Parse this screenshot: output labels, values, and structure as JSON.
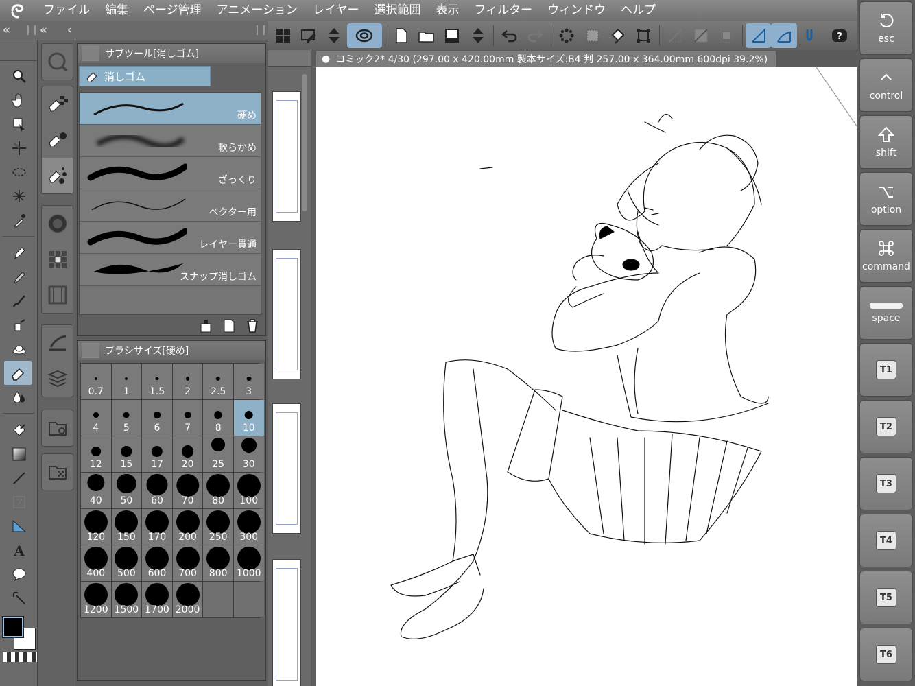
{
  "menu": {
    "items": [
      "ファイル",
      "編集",
      "ページ管理",
      "アニメーション",
      "レイヤー",
      "選択範囲",
      "表示",
      "フィルター",
      "ウィンドウ",
      "ヘルプ"
    ]
  },
  "subtool_panel": {
    "title": "サブツール[消しゴム]",
    "group_name": "消しゴム",
    "items": [
      {
        "label": "硬め",
        "selected": true
      },
      {
        "label": "軟らかめ",
        "selected": false
      },
      {
        "label": "ざっくり",
        "selected": false
      },
      {
        "label": "ベクター用",
        "selected": false
      },
      {
        "label": "レイヤー貫通",
        "selected": false
      },
      {
        "label": "スナップ消しゴム",
        "selected": false
      }
    ]
  },
  "brush_size_panel": {
    "title": "ブラシサイズ[硬め]",
    "selected": "10",
    "sizes": [
      "0.7",
      "1",
      "1.5",
      "2",
      "2.5",
      "3",
      "4",
      "5",
      "6",
      "7",
      "8",
      "10",
      "12",
      "15",
      "17",
      "20",
      "25",
      "30",
      "40",
      "50",
      "60",
      "70",
      "80",
      "100",
      "120",
      "150",
      "170",
      "200",
      "250",
      "300",
      "400",
      "500",
      "600",
      "700",
      "800",
      "1000",
      "1200",
      "1500",
      "1700",
      "2000"
    ]
  },
  "document": {
    "tab_title": "コミック2* 4/30 (297.00 x 420.00mm 製本サイズ:B4 判 257.00 x 364.00mm 600dpi 39.2%)"
  },
  "shortcuts": {
    "keys": [
      {
        "label": "esc",
        "icon": "undo-circle-icon"
      },
      {
        "label": "control",
        "icon": "caret-up-icon"
      },
      {
        "label": "shift",
        "icon": "shift-arrow-icon"
      },
      {
        "label": "option",
        "icon": "option-icon"
      },
      {
        "label": "command",
        "icon": "command-icon"
      },
      {
        "label": "space",
        "icon": "space-bar-icon"
      }
    ],
    "tkeys": [
      "T1",
      "T2",
      "T3",
      "T4",
      "T5",
      "T6"
    ]
  },
  "colors": {
    "main": "#000000",
    "sub": "#ffffff",
    "accent": "#8fb1c8"
  }
}
